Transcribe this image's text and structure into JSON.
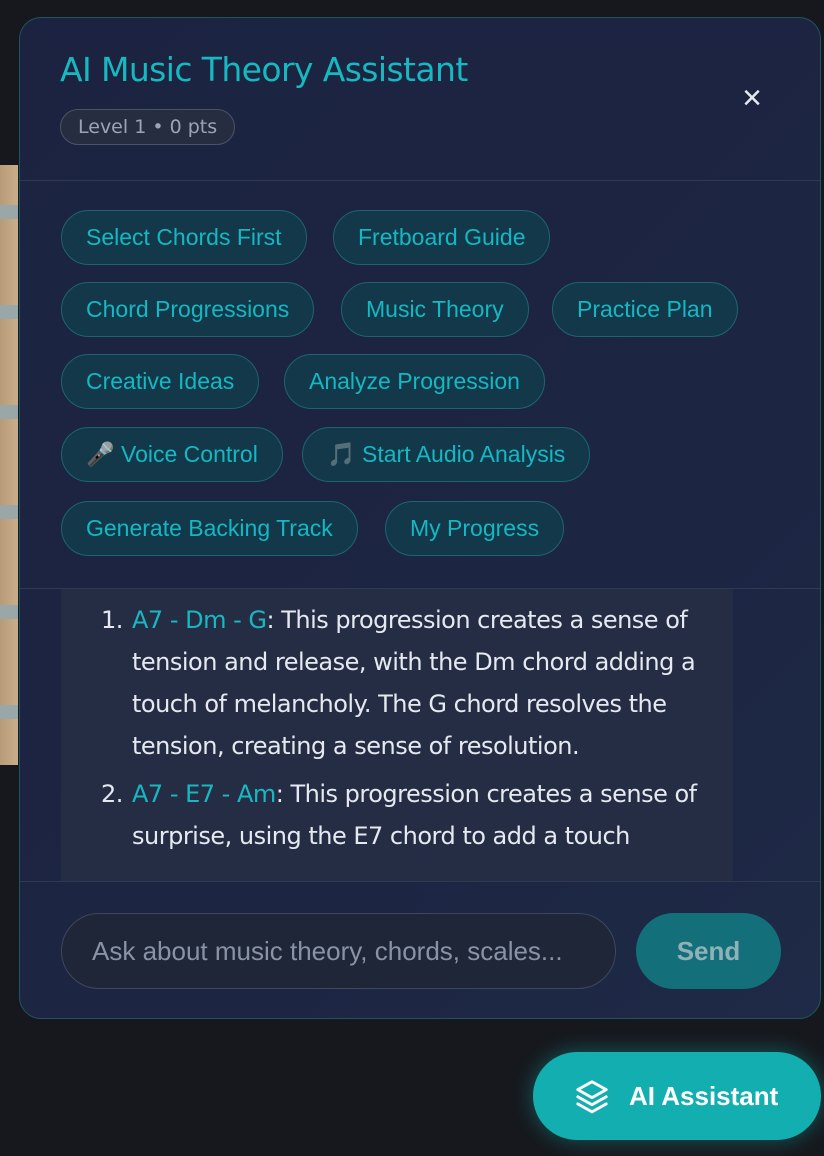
{
  "header": {
    "title": "AI Music Theory Assistant",
    "level_badge": "Level 1 • 0 pts",
    "close_symbol": "×"
  },
  "quick_actions": [
    {
      "label": "Select Chords First"
    },
    {
      "label": "Fretboard Guide"
    },
    {
      "label": "Chord Progressions"
    },
    {
      "label": "Music Theory"
    },
    {
      "label": "Practice Plan"
    },
    {
      "label": "Creative Ideas"
    },
    {
      "label": "Analyze Progression"
    },
    {
      "label": "🎤 Voice Control",
      "icon": "microphone-icon"
    },
    {
      "label": "🎵 Start Audio Analysis",
      "icon": "music-note-icon"
    },
    {
      "label": "Generate Backing Track"
    },
    {
      "label": "My Progress"
    }
  ],
  "chat": {
    "items": [
      {
        "progression": "A7 - Dm - G",
        "text": ": This progression creates a sense of tension and release, with the Dm chord adding a touch of melancholy. The G chord resolves the tension, creating a sense of resolution."
      },
      {
        "progression": "A7 - E7 - Am",
        "text": ": This progression creates a sense of surprise, using the E7 chord to add a touch"
      }
    ]
  },
  "input": {
    "placeholder": "Ask about music theory, chords, scales...",
    "send_label": "Send"
  },
  "fab": {
    "label": "AI Assistant",
    "icon": "layers-icon"
  },
  "colors": {
    "accent": "#18b8c0",
    "panel_bg": "#1b2340",
    "fab_bg": "#13afb0"
  }
}
